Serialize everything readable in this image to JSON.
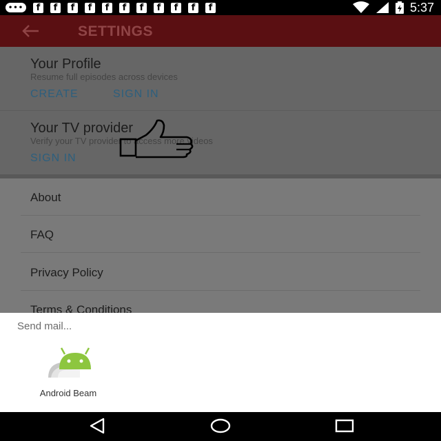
{
  "status_bar": {
    "time": "5:37",
    "notification_icons": [
      "messages-icon",
      "facebook-icon",
      "facebook-icon",
      "facebook-icon",
      "facebook-icon",
      "facebook-icon",
      "facebook-icon",
      "facebook-icon",
      "facebook-icon",
      "facebook-icon",
      "facebook-icon",
      "facebook-icon"
    ],
    "status_icons": [
      "wifi-icon",
      "signal-icon",
      "battery-charging-icon"
    ]
  },
  "toolbar": {
    "title": "SETTINGS",
    "back_icon": "arrow-left-icon",
    "background": "#5a0f12"
  },
  "profile": {
    "title": "Your Profile",
    "subtitle": "Resume full episodes across devices",
    "create_label": "CREATE",
    "sign_in_label": "SIGN IN"
  },
  "tv_provider": {
    "title": "Your TV provider",
    "subtitle": "Verify your TV provider to access more videos",
    "sign_in_label": "SIGN IN"
  },
  "menu": {
    "items": [
      {
        "label": "About"
      },
      {
        "label": "FAQ"
      },
      {
        "label": "Privacy Policy"
      },
      {
        "label": "Terms & Conditions"
      }
    ]
  },
  "overlay": {
    "icon": "thumbs-up-icon"
  },
  "share_sheet": {
    "title": "Send mail...",
    "targets": [
      {
        "label": "Android Beam",
        "icon": "android-beam-icon"
      }
    ]
  },
  "nav_bar": {
    "buttons": [
      "back-triangle-icon",
      "home-circle-icon",
      "recents-square-icon"
    ]
  },
  "colors": {
    "accent": "#2c5f7e",
    "toolbar": "#5a0f12",
    "sheet": "#ffffff"
  }
}
